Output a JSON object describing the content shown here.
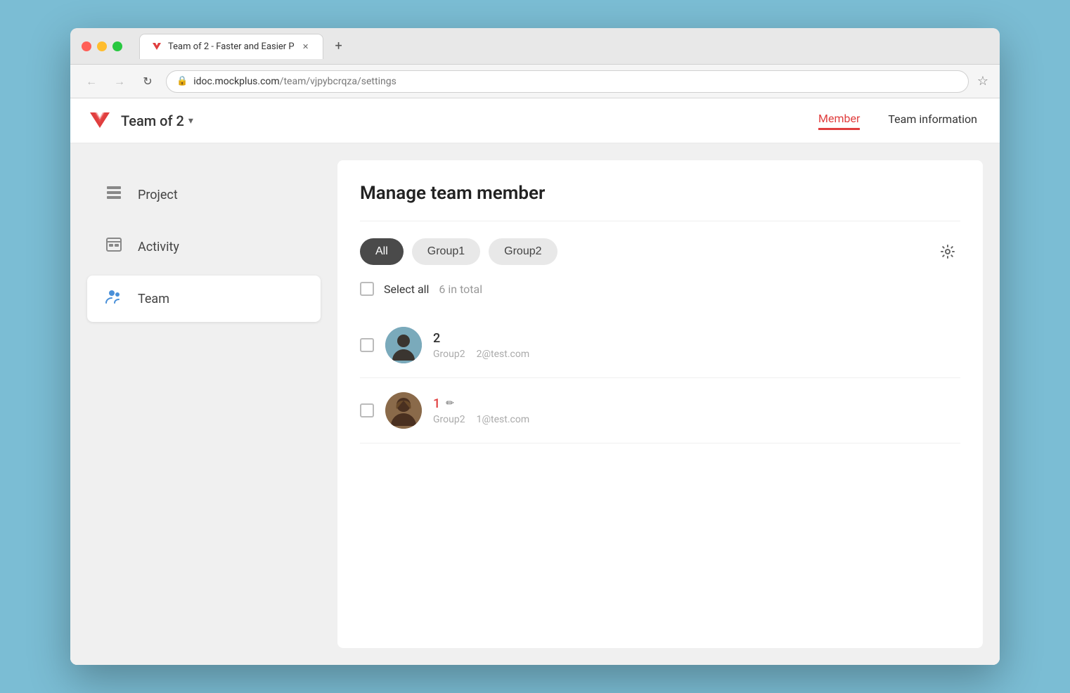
{
  "browser": {
    "tab_title": "Team of 2 - Faster and Easier P",
    "url_domain": "idoc.mockplus.com",
    "url_path": "/team/vjpybcrqza/settings",
    "new_tab_label": "+"
  },
  "header": {
    "team_name": "Team of 2",
    "tabs": [
      {
        "id": "member",
        "label": "Member",
        "active": true
      },
      {
        "id": "team-information",
        "label": "Team information",
        "active": false
      }
    ]
  },
  "sidebar": {
    "items": [
      {
        "id": "project",
        "label": "Project",
        "icon": "project-icon",
        "active": false
      },
      {
        "id": "activity",
        "label": "Activity",
        "icon": "activity-icon",
        "active": false
      },
      {
        "id": "team",
        "label": "Team",
        "icon": "team-icon",
        "active": true
      }
    ]
  },
  "main": {
    "title": "Manage team member",
    "filters": [
      {
        "id": "all",
        "label": "All",
        "active": true
      },
      {
        "id": "group1",
        "label": "Group1",
        "active": false
      },
      {
        "id": "group2",
        "label": "Group2",
        "active": false
      }
    ],
    "select_all_label": "Select all",
    "total_label": "6 in total",
    "members": [
      {
        "id": "member-2",
        "name": "2",
        "name_color": "normal",
        "group": "Group2",
        "email": "2@test.com",
        "avatar_type": "photo1"
      },
      {
        "id": "member-1",
        "name": "1",
        "name_color": "red",
        "group": "Group2",
        "email": "1@test.com",
        "avatar_type": "photo2",
        "has_edit": true
      }
    ]
  }
}
